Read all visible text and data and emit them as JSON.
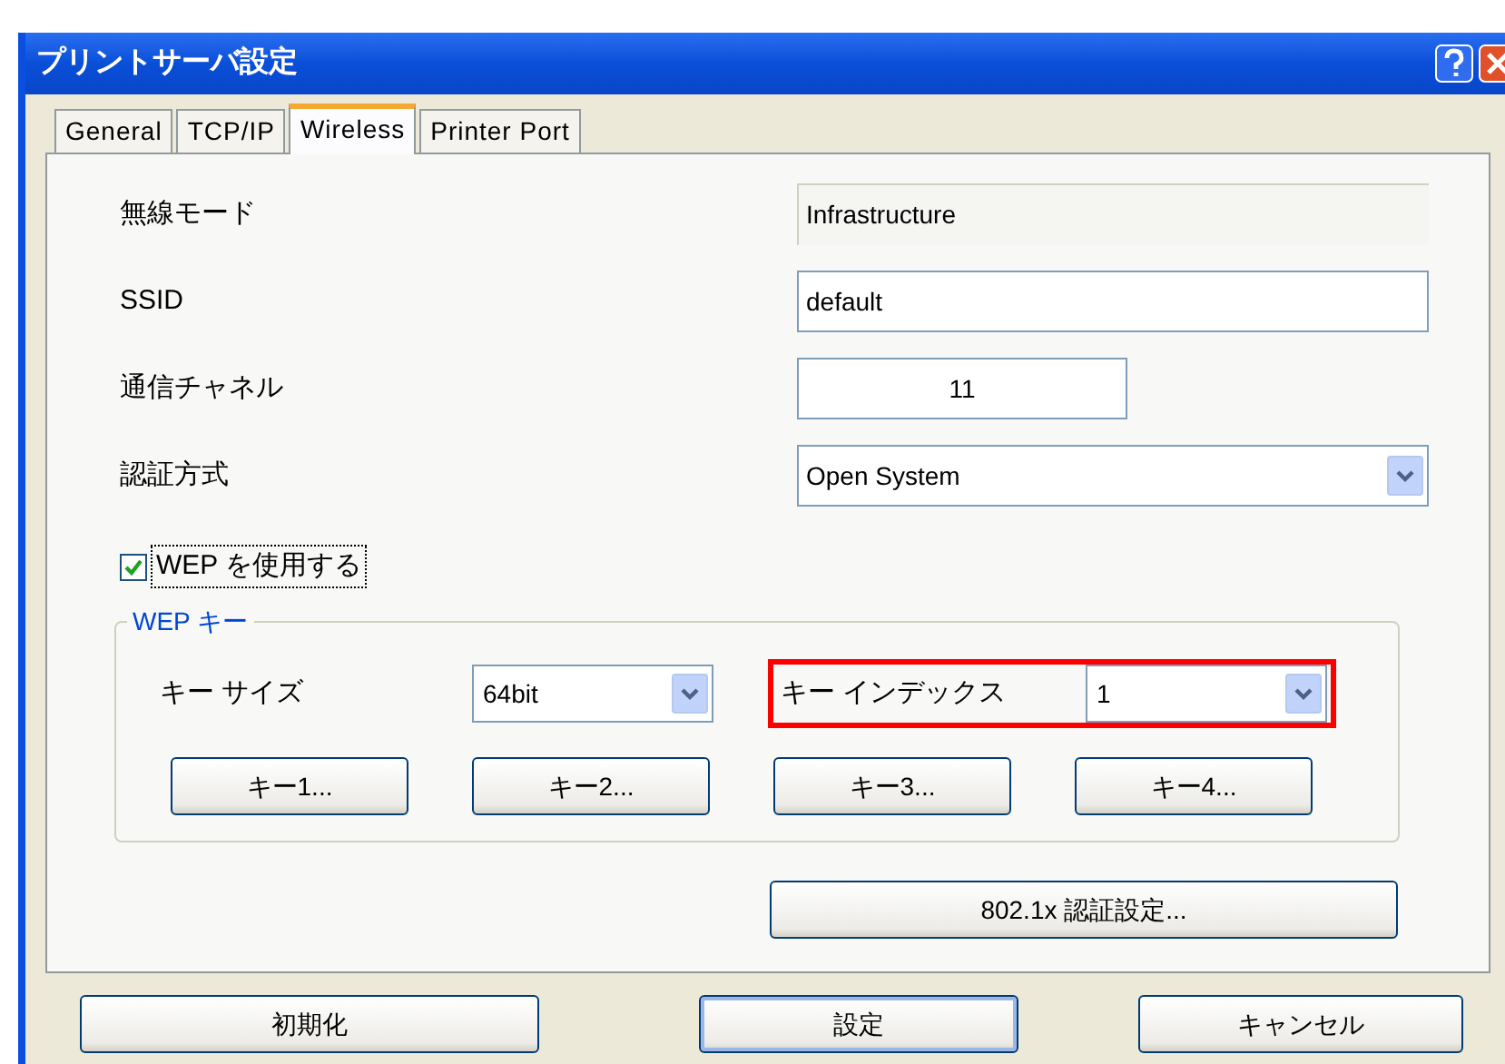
{
  "window": {
    "title": "プリントサーバ設定"
  },
  "tabs": [
    {
      "label": "General",
      "selected": false
    },
    {
      "label": "TCP/IP",
      "selected": false
    },
    {
      "label": "Wireless",
      "selected": true
    },
    {
      "label": "Printer Port",
      "selected": false
    }
  ],
  "fields": [
    {
      "label": "無線モード",
      "kind": "readonly",
      "value": "Infrastructure"
    },
    {
      "label": "SSID",
      "kind": "text",
      "value": "default"
    },
    {
      "label": "通信チャネル",
      "kind": "short",
      "value": "11"
    },
    {
      "label": "認証方式",
      "kind": "select",
      "value": "Open System"
    }
  ],
  "use_wep": {
    "label": "WEP を使用する",
    "checked": true
  },
  "wep_group": {
    "title": "WEP キー",
    "key_size": {
      "label": "キー サイズ",
      "value": "64bit"
    },
    "key_index": {
      "label": "キー インデックス",
      "value": "1",
      "highlighted": true
    },
    "key_buttons": [
      "キー1...",
      "キー2...",
      "キー3...",
      "キー4..."
    ]
  },
  "auth_button": "802.1x 認証設定...",
  "footer_buttons": [
    {
      "label": "初期化",
      "default": false
    },
    {
      "label": "設定",
      "default": true
    },
    {
      "label": "キャンセル",
      "default": false
    }
  ]
}
